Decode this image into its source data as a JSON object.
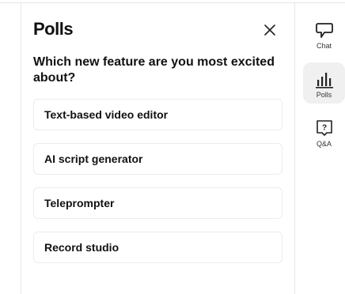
{
  "panel": {
    "title": "Polls",
    "close_icon": "close-icon"
  },
  "poll": {
    "question": "Which new feature are you most excited about?",
    "options": [
      {
        "label": "Text-based video editor"
      },
      {
        "label": "AI script generator"
      },
      {
        "label": "Teleprompter"
      },
      {
        "label": "Record studio"
      }
    ]
  },
  "rail": {
    "active": "Polls",
    "items": [
      {
        "label": "Chat",
        "icon": "chat-bubble-icon"
      },
      {
        "label": "Polls",
        "icon": "bar-chart-icon"
      },
      {
        "label": "Q&A",
        "icon": "question-box-icon"
      }
    ]
  }
}
